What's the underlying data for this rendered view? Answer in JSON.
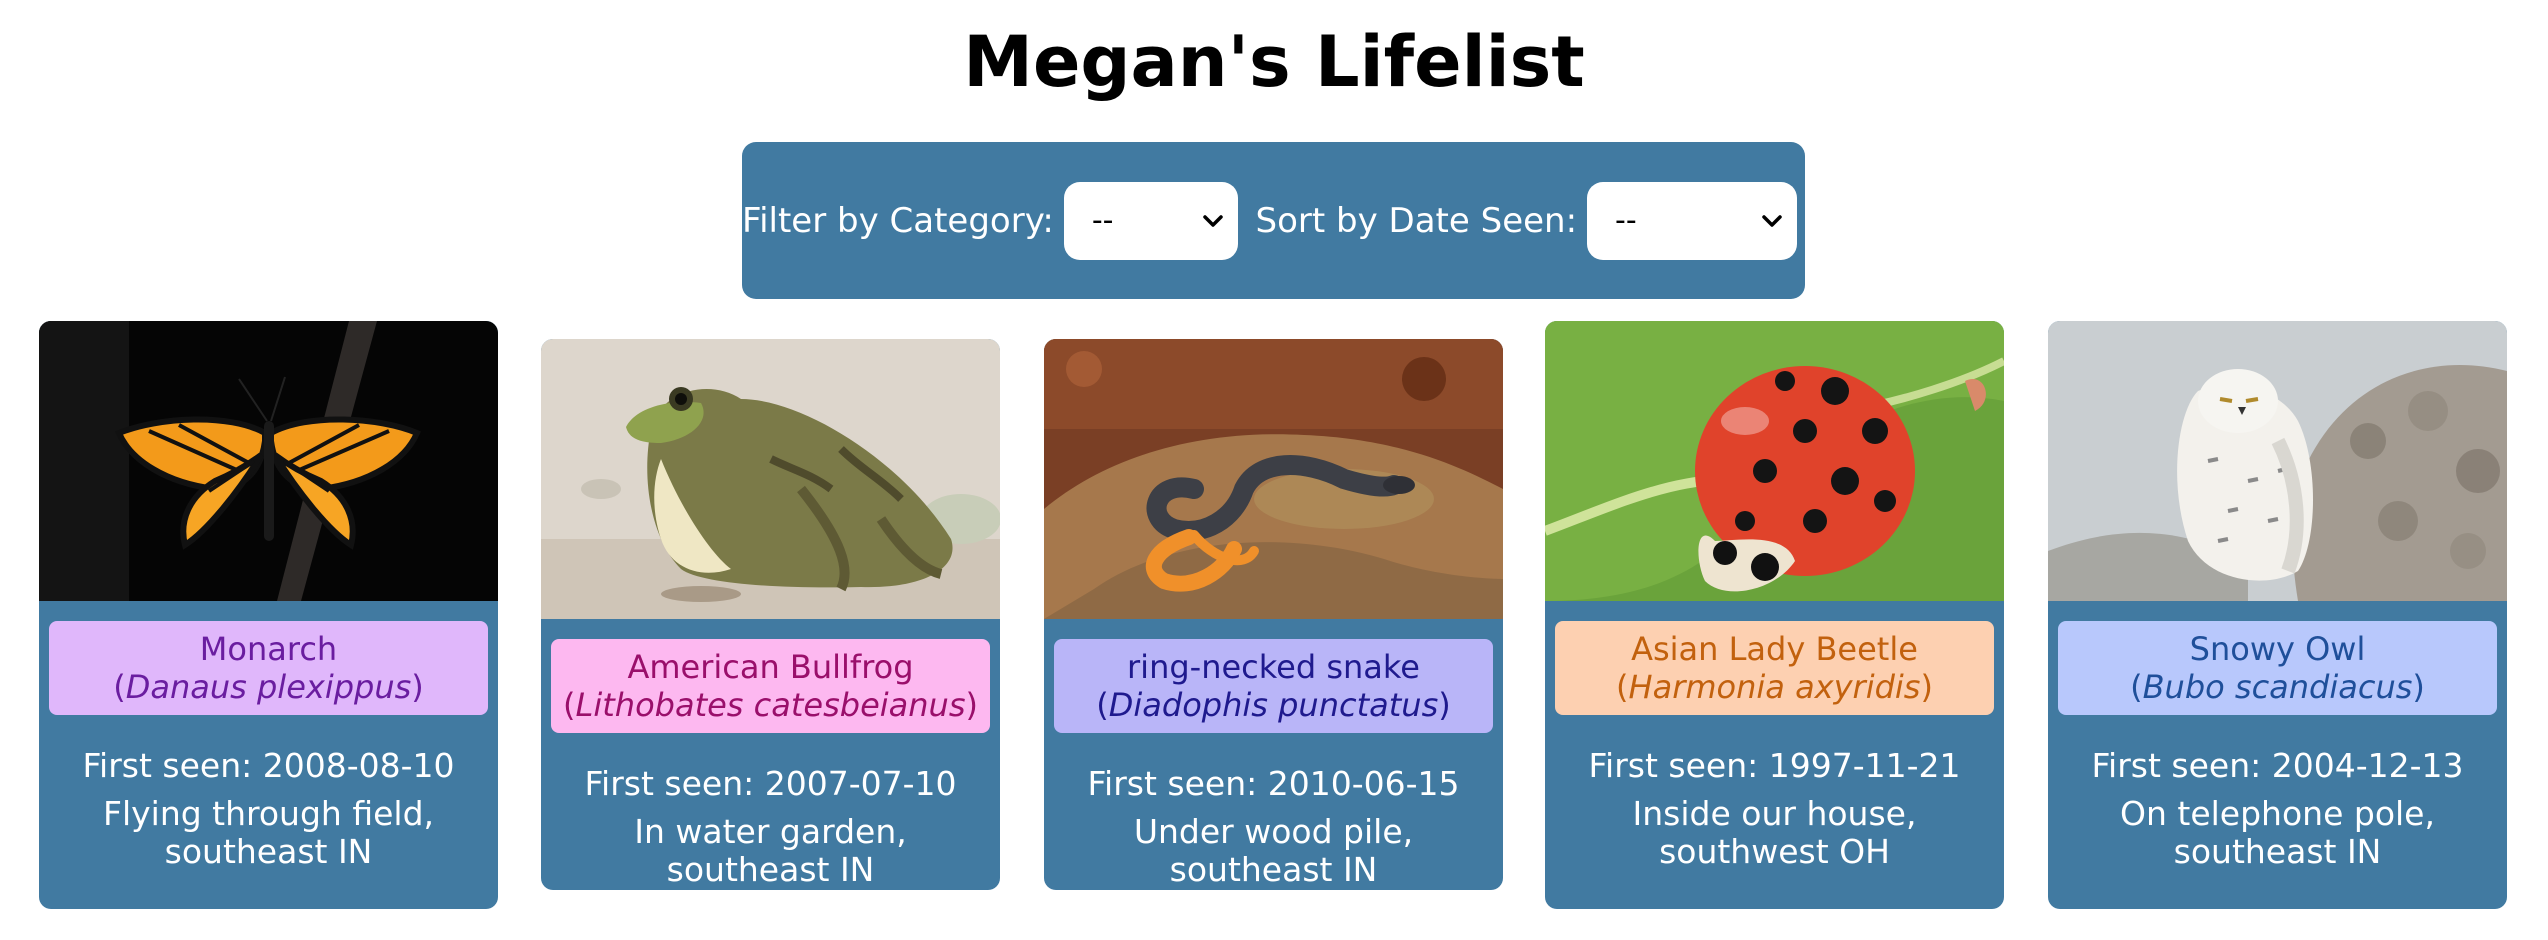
{
  "page": {
    "title": "Megan's Lifelist"
  },
  "controls": {
    "filter_label": "Filter by Category:",
    "filter_value": "--",
    "sort_label": "Sort by Date Seen:",
    "sort_value": "--"
  },
  "colors": {
    "panel": "#417aa1",
    "butterfly_bg": "#e0b7fb",
    "butterfly_text": "#6a1da0",
    "amphibian_bg": "#fdb8f0",
    "amphibian_text": "#9a0f6b",
    "reptile_bg": "#b9b5f8",
    "reptile_text": "#1f1a8e",
    "insect_bg": "#fdd0b1",
    "insect_text": "#c2610e",
    "bird_bg": "#b8c8fc",
    "bird_text": "#1f4f9a"
  },
  "cards": [
    {
      "common": "Monarch",
      "scientific": "Danaus plexippus",
      "seen_prefix": "First seen: ",
      "seen": "2008-08-10",
      "location": "Flying through field, southeast IN",
      "photo_icon": "monarch-butterfly-photo"
    },
    {
      "common": "American Bullfrog",
      "scientific": "Lithobates catesbeianus",
      "seen_prefix": "First seen: ",
      "seen": "2007-07-10",
      "location": "In water garden, southeast IN",
      "photo_icon": "bullfrog-photo"
    },
    {
      "common": "ring-necked snake",
      "scientific": "Diadophis punctatus",
      "seen_prefix": "First seen: ",
      "seen": "2010-06-15",
      "location": "Under wood pile, southeast IN",
      "photo_icon": "ring-necked-snake-photo"
    },
    {
      "common": "Asian Lady Beetle",
      "scientific": "Harmonia axyridis",
      "seen_prefix": "First seen: ",
      "seen": "1997-11-21",
      "location": "Inside our house, southwest OH",
      "photo_icon": "lady-beetle-photo"
    },
    {
      "common": "Snowy Owl",
      "scientific": "Bubo scandiacus",
      "seen_prefix": "First seen: ",
      "seen": "2004-12-13",
      "location": "On telephone pole, southeast IN",
      "photo_icon": "snowy-owl-photo"
    }
  ]
}
